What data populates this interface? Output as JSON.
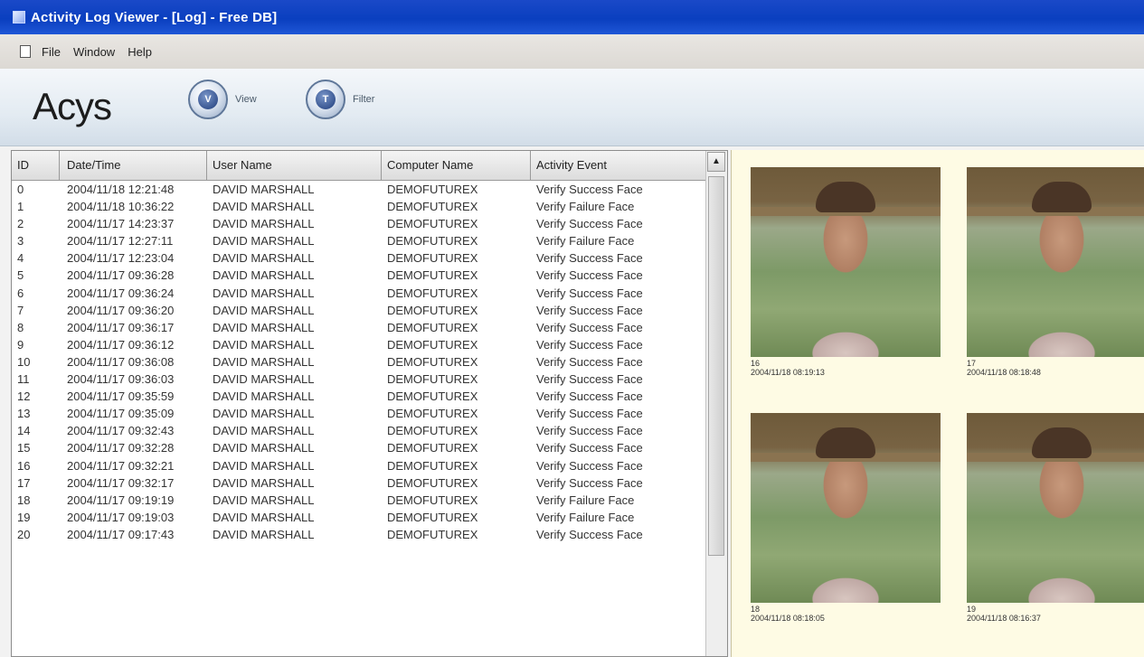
{
  "window": {
    "title": "Activity Log Viewer - [Log] - Free DB]"
  },
  "menu": {
    "items": [
      "File",
      "Window",
      "Help"
    ]
  },
  "toolbar": {
    "logo": "Acys",
    "buttons": [
      {
        "icon": "V",
        "label": "View"
      },
      {
        "icon": "T",
        "label": "Filter"
      }
    ]
  },
  "table": {
    "columns": [
      "ID",
      "Date/Time",
      "User Name",
      "Computer Name",
      "Activity Event"
    ],
    "rows": [
      [
        "0",
        "2004/11/18 12:21:48",
        "DAVID MARSHALL",
        "DEMOFUTUREX",
        "Verify Success Face"
      ],
      [
        "1",
        "2004/11/18 10:36:22",
        "DAVID MARSHALL",
        "DEMOFUTUREX",
        "Verify Failure Face"
      ],
      [
        "2",
        "2004/11/17 14:23:37",
        "DAVID MARSHALL",
        "DEMOFUTUREX",
        "Verify Success Face"
      ],
      [
        "3",
        "2004/11/17 12:27:11",
        "DAVID MARSHALL",
        "DEMOFUTUREX",
        "Verify Failure Face"
      ],
      [
        "4",
        "2004/11/17 12:23:04",
        "DAVID MARSHALL",
        "DEMOFUTUREX",
        "Verify Success Face"
      ],
      [
        "5",
        "2004/11/17 09:36:28",
        "DAVID MARSHALL",
        "DEMOFUTUREX",
        "Verify Success Face"
      ],
      [
        "6",
        "2004/11/17 09:36:24",
        "DAVID MARSHALL",
        "DEMOFUTUREX",
        "Verify Success Face"
      ],
      [
        "7",
        "2004/11/17 09:36:20",
        "DAVID MARSHALL",
        "DEMOFUTUREX",
        "Verify Success Face"
      ],
      [
        "8",
        "2004/11/17 09:36:17",
        "DAVID MARSHALL",
        "DEMOFUTUREX",
        "Verify Success Face"
      ],
      [
        "9",
        "2004/11/17 09:36:12",
        "DAVID MARSHALL",
        "DEMOFUTUREX",
        "Verify Success Face"
      ],
      [
        "10",
        "2004/11/17 09:36:08",
        "DAVID MARSHALL",
        "DEMOFUTUREX",
        "Verify Success Face"
      ],
      [
        "11",
        "2004/11/17 09:36:03",
        "DAVID MARSHALL",
        "DEMOFUTUREX",
        "Verify Success Face"
      ],
      [
        "12",
        "2004/11/17 09:35:59",
        "DAVID MARSHALL",
        "DEMOFUTUREX",
        "Verify Success Face"
      ],
      [
        "13",
        "2004/11/17 09:35:09",
        "DAVID MARSHALL",
        "DEMOFUTUREX",
        "Verify Success Face"
      ],
      [
        "14",
        "2004/11/17 09:32:43",
        "DAVID MARSHALL",
        "DEMOFUTUREX",
        "Verify Success Face"
      ],
      [
        "15",
        "2004/11/17 09:32:28",
        "DAVID MARSHALL",
        "DEMOFUTUREX",
        "Verify Success Face"
      ],
      [
        "16",
        "2004/11/17 09:32:21",
        "DAVID MARSHALL",
        "DEMOFUTUREX",
        "Verify Success Face"
      ],
      [
        "17",
        "2004/11/17 09:32:17",
        "DAVID MARSHALL",
        "DEMOFUTUREX",
        "Verify Success Face"
      ],
      [
        "18",
        "2004/11/17 09:19:19",
        "DAVID MARSHALL",
        "DEMOFUTUREX",
        "Verify Failure Face"
      ],
      [
        "19",
        "2004/11/17 09:19:03",
        "DAVID MARSHALL",
        "DEMOFUTUREX",
        "Verify Failure Face"
      ],
      [
        "20",
        "2004/11/17 09:17:43",
        "DAVID MARSHALL",
        "DEMOFUTUREX",
        "Verify Success Face"
      ]
    ]
  },
  "images": [
    {
      "id": "16",
      "timestamp": "2004/11/18 08:19:13"
    },
    {
      "id": "17",
      "timestamp": "2004/11/18 08:18:48"
    },
    {
      "id": "18",
      "timestamp": "2004/11/18 08:18:05"
    },
    {
      "id": "19",
      "timestamp": "2004/11/18 08:16:37"
    }
  ]
}
